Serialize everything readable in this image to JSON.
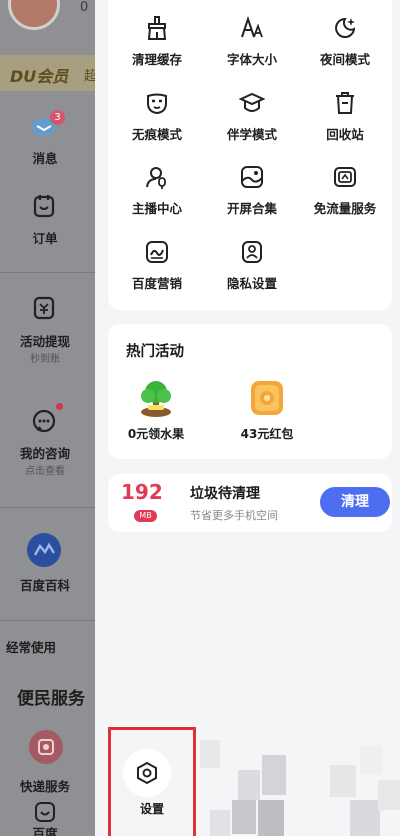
{
  "sidebar": {
    "avatar_number": "0",
    "vip_label": "DU会员",
    "vip_suffix": "超",
    "items": [
      {
        "name": "messages",
        "label": "消息",
        "badge": "3"
      },
      {
        "name": "orders",
        "label": "订单"
      },
      {
        "name": "cashout",
        "label": "活动提现",
        "sub": "秒到账"
      },
      {
        "name": "consult",
        "label": "我的咨询",
        "sub": "点击查看"
      },
      {
        "name": "baike",
        "label": "百度百科"
      }
    ],
    "section_often": "经常使用",
    "section_services": "便民服务",
    "express_label": "快递服务",
    "bottom_label": "百度"
  },
  "tools": [
    {
      "label": "清理缓存",
      "icon": "broom-icon"
    },
    {
      "label": "字体大小",
      "icon": "font-size-icon"
    },
    {
      "label": "夜间模式",
      "icon": "moon-icon"
    },
    {
      "label": "无痕模式",
      "icon": "mask-icon"
    },
    {
      "label": "伴学模式",
      "icon": "graduation-cap-icon"
    },
    {
      "label": "回收站",
      "icon": "trash-icon"
    },
    {
      "label": "主播中心",
      "icon": "anchor-user-icon"
    },
    {
      "label": "开屏合集",
      "icon": "splash-screen-icon"
    },
    {
      "label": "免流量服务",
      "icon": "data-free-icon"
    },
    {
      "label": "百度营销",
      "icon": "marketing-icon"
    },
    {
      "label": "隐私设置",
      "icon": "privacy-icon"
    }
  ],
  "hot": {
    "title": "热门活动",
    "items": [
      {
        "label": "0元领水果",
        "icon": "fruit-tree-icon"
      },
      {
        "label": "43元红包",
        "icon": "red-packet-icon"
      }
    ]
  },
  "cleanup": {
    "size": "192",
    "unit": "MB",
    "title": "垃圾待清理",
    "subtitle": "节省更多手机空间",
    "button": "清理"
  },
  "settings": {
    "label": "设置",
    "icon": "settings-hex-icon"
  },
  "colors": {
    "accent_blue": "#4e6ef2",
    "accent_red": "#e23a52",
    "highlight_border": "#e02f3a"
  }
}
